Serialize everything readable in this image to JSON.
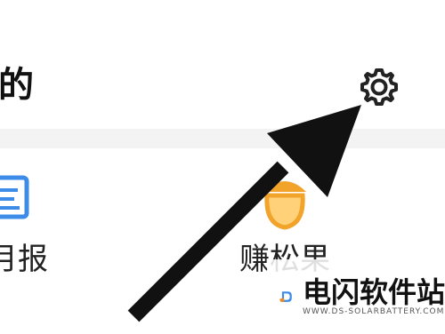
{
  "header": {
    "title": "的",
    "settings_icon": "gear-icon"
  },
  "grid": {
    "items": [
      {
        "label": "月报",
        "icon": "report-icon"
      },
      {
        "label": "赚松果",
        "icon": "acorn-icon"
      }
    ]
  },
  "watermark": {
    "title": "电闪软件站",
    "url": "WWW.DS-SOLARBATTERY.COM"
  },
  "colors": {
    "accent_blue": "#3c8ce8",
    "acorn_orange": "#f2a32a",
    "arrow": "#111111"
  }
}
